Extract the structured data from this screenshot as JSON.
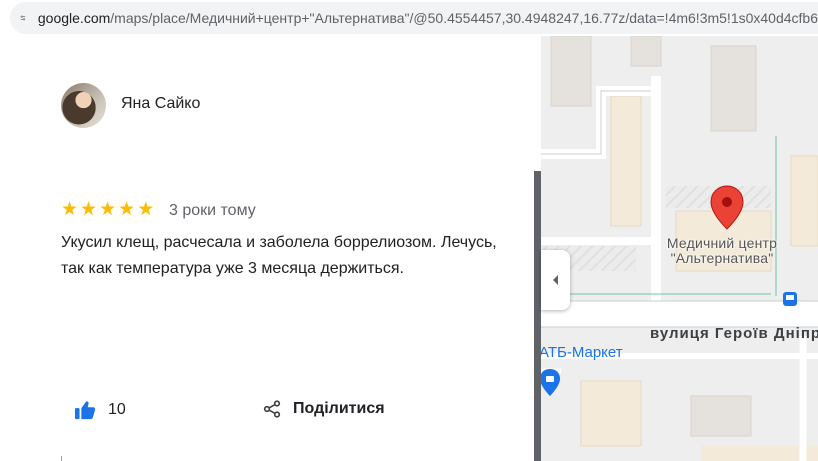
{
  "browser": {
    "url_host": "google.com",
    "url_path": "/maps/place/Медичний+центр+\"Альтернатива\"/@50.4554457,30.4948247,16.77z/data=!4m6!3m5!1s0x40d4cfb6"
  },
  "review": {
    "author": "Яна Сайко",
    "rating": 5,
    "stars": [
      "★",
      "★",
      "★",
      "★",
      "★"
    ],
    "date": "3 роки тому",
    "text": "Укусил клещ, расчесала и заболела боррелиозом. Лечусь, так как температура уже 3 месяца держиться.",
    "likes": "10",
    "share_label": "Поділитися"
  },
  "map": {
    "place_line1": "Медичний центр",
    "place_line2": "\"Альтернатива\"",
    "street": "вулиця Героїв Дніпра",
    "poi": "АТБ-Маркет",
    "colors": {
      "pin": "#ea4335",
      "poi": "#1a73e8",
      "transit": "#1a73e8",
      "star": "#fbbc04"
    }
  }
}
